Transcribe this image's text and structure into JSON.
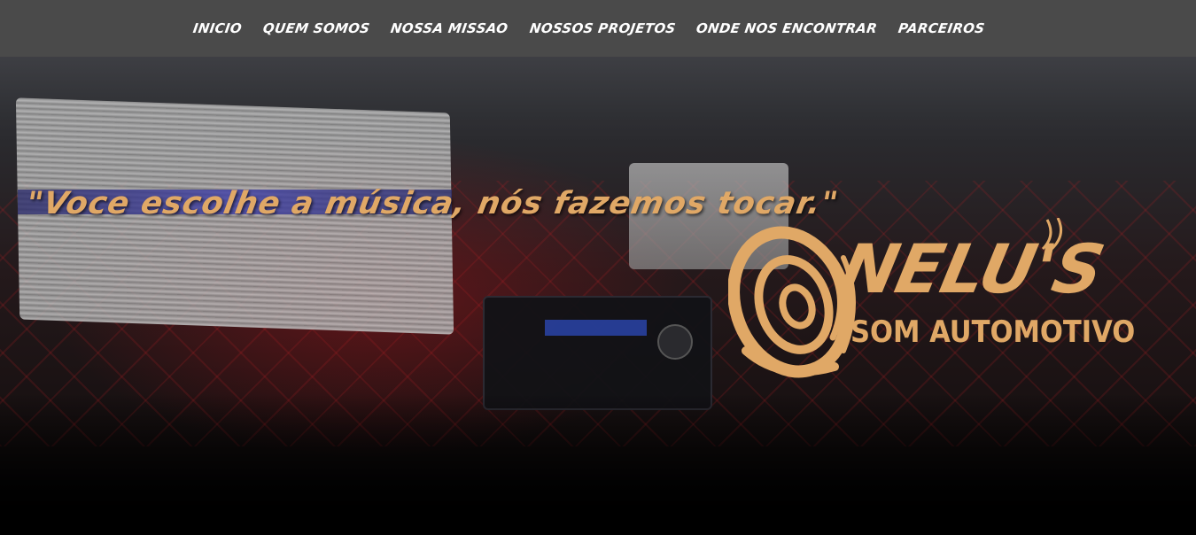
{
  "nav": {
    "items": [
      {
        "label": "INICIO"
      },
      {
        "label": "QUEM SOMOS"
      },
      {
        "label": "NOSSA MISSAO"
      },
      {
        "label": "NOSSOS PROJETOS"
      },
      {
        "label": "ONDE NOS ENCONTRAR"
      },
      {
        "label": "PARCEIROS"
      }
    ]
  },
  "hero": {
    "slogan": "\"Voce escolhe a música, nós fazemos tocar.\"",
    "logo": {
      "name": "NELU'S",
      "subtitle": "SOM AUTOMOTIVO",
      "icon": "speaker-waves-icon"
    }
  },
  "colors": {
    "nav_background": "#4a4a4a",
    "nav_text": "#ffffff",
    "accent_gold": "#e0a866"
  }
}
